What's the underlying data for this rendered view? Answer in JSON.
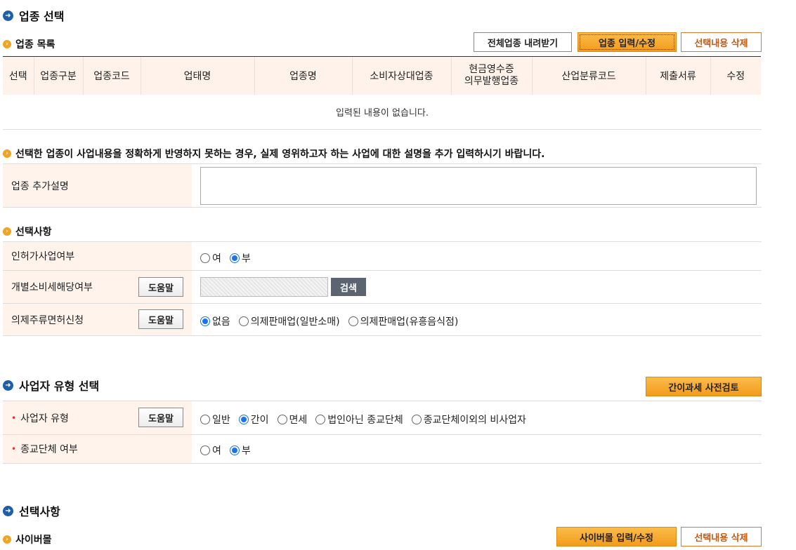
{
  "section1": {
    "title": "업종 선택"
  },
  "biz_list": {
    "title": "업종 목록",
    "download_btn": "전체업종 내려받기",
    "input_btn": "업종 입력/수정",
    "delete_btn": "선택내용 삭제",
    "columns": [
      "선택",
      "업종구분",
      "업종코드",
      "업태명",
      "업종명",
      "소비자상대업종",
      "현금영수증\n의무발행업종",
      "산업분류코드",
      "제출서류",
      "수정"
    ],
    "empty_text": "입력된 내용이 없습니다."
  },
  "notice": {
    "text": "선택한 업종이 사업내용을 정확하게 반영하지 못하는 경우, 실제 영위하고자 하는 사업에 대한 설명을 추가 입력하시기 바랍니다."
  },
  "extra_desc": {
    "label": "업종 추가설명",
    "value": ""
  },
  "options": {
    "title": "선택사항",
    "license": {
      "label": "인허가사업여부",
      "options": [
        "여",
        "부"
      ],
      "selected": "부"
    },
    "excise": {
      "label": "개별소비세해당여부",
      "help": "도움말",
      "search": "검색"
    },
    "liquor": {
      "label": "의제주류면허신청",
      "help": "도움말",
      "options": [
        "없음",
        "의제판매업(일반소매)",
        "의제판매업(유흥음식점)"
      ],
      "selected": "없음"
    }
  },
  "section2": {
    "title": "사업자 유형 선택",
    "precheck_btn": "간이과세 사전검토"
  },
  "biz_type": {
    "type": {
      "label": "사업자 유형",
      "help": "도움말",
      "options": [
        "일반",
        "간이",
        "면세",
        "법인아닌 종교단체",
        "종교단체이외의 비사업자"
      ],
      "selected": "간이"
    },
    "religious": {
      "label": "종교단체 여부",
      "options": [
        "여",
        "부"
      ],
      "selected": "부"
    }
  },
  "section3": {
    "title": "선택사항"
  },
  "cybermall": {
    "title": "사이버몰",
    "input_btn": "사이버몰 입력/수정",
    "delete_btn": "선택내용 삭제"
  },
  "colors": {
    "accent_orange": "#f39b1c",
    "header_bg": "#fff2ea",
    "blue": "#1f5fa8"
  }
}
